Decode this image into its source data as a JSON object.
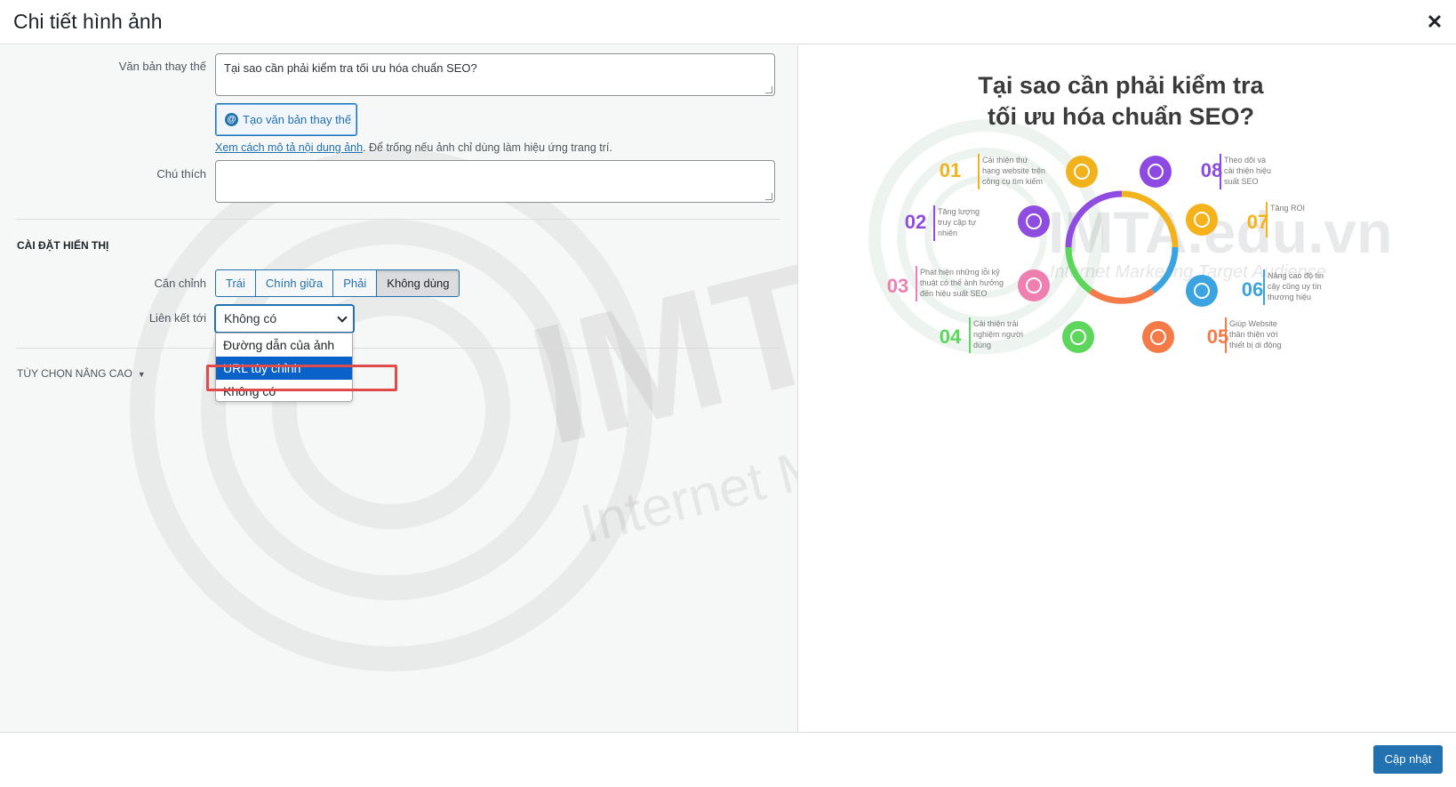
{
  "header": {
    "title": "Chi tiết hình ảnh",
    "close_icon": "close-icon"
  },
  "form": {
    "alt_text_label": "Văn bản thay thế",
    "alt_text_value": "Tại sao cần phải kiểm tra tối ưu hóa chuẩn SEO?",
    "ai_button_label": "Tạo văn bản thay thế",
    "help_link": "Xem cách mô tả nội dung ảnh",
    "help_text": ". Để trống nếu ảnh chỉ dùng làm hiệu ứng trang trí.",
    "caption_label": "Chú thích",
    "caption_value": ""
  },
  "display_settings": {
    "heading": "CÀI ĐẶT HIỂN THỊ",
    "align_label": "Căn chỉnh",
    "align_options": [
      "Trái",
      "Chính giữa",
      "Phải",
      "Không dùng"
    ],
    "align_selected": "Không dùng",
    "link_label": "Liên kết tới",
    "link_value": "Không có",
    "link_options": [
      "Đường dẫn của ảnh",
      "URL tùy chỉnh",
      "Không có"
    ],
    "link_highlighted": "URL tùy chỉnh"
  },
  "advanced": {
    "label": "TÙY CHỌN NÂNG CAO"
  },
  "preview": {
    "title_line1": "Tại sao cần phải kiểm tra",
    "title_line2": "tối ưu hóa chuẩn SEO?",
    "watermark_main": "IMTA.edu.vn",
    "watermark_sub": "Internet Marketing Target Audience",
    "items": [
      {
        "num": "01",
        "text": [
          "Cải thiện thứ",
          "hạng website trên",
          "công cụ tìm kiếm"
        ],
        "color": "#f2b21c"
      },
      {
        "num": "02",
        "text": [
          "Tăng lượng",
          "truy cập tự",
          "nhiên"
        ],
        "color": "#8e4de0"
      },
      {
        "num": "03",
        "text": [
          "Phát hiện những lỗi kỹ",
          "thuật có thể ảnh hưởng",
          "đến hiệu suất SEO"
        ],
        "color": "#ee7fb0"
      },
      {
        "num": "04",
        "text": [
          "Cải thiện trải",
          "nghiệm người",
          "dùng"
        ],
        "color": "#5dd65c"
      },
      {
        "num": "05",
        "text": [
          "Giúp Website",
          "thân thiện với",
          "thiết bị di động"
        ],
        "color": "#f47b48"
      },
      {
        "num": "06",
        "text": [
          "Nâng cao độ tin",
          "cậy cũng uy tín",
          "thương hiệu"
        ],
        "color": "#3aa3e0"
      },
      {
        "num": "07",
        "text": [
          "Tăng ROI"
        ],
        "color": "#f5b21b"
      },
      {
        "num": "08",
        "text": [
          "Theo dõi và",
          "cải thiện hiệu",
          "suất SEO"
        ],
        "color": "#8d4ae3"
      }
    ]
  },
  "footer": {
    "update_label": "Cập nhật"
  }
}
